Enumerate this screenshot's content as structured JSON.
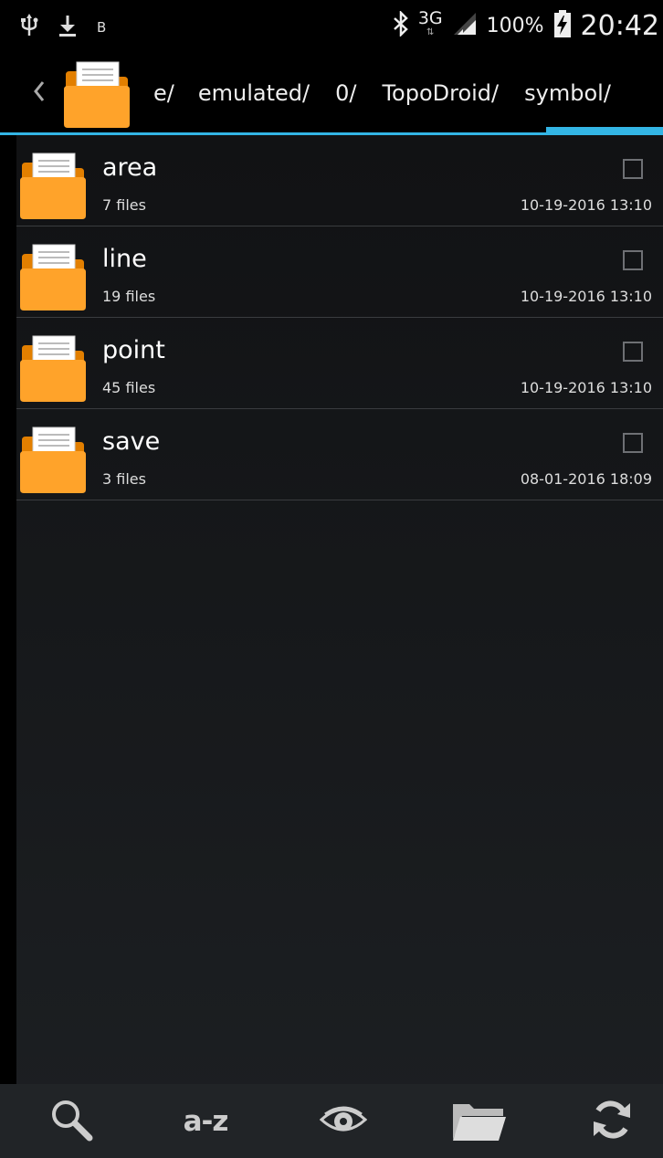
{
  "status_bar": {
    "left_icons": [
      "usb-icon",
      "download-icon"
    ],
    "b_label": "B",
    "network_type": "3G",
    "battery_percent": "100%",
    "clock": "20:42"
  },
  "path_bar": {
    "crumbs": [
      "e/",
      "emulated/",
      "0/",
      "TopoDroid/",
      "symbol/"
    ]
  },
  "files": [
    {
      "name": "area",
      "count": "7 files",
      "date": "10-19-2016 13:10"
    },
    {
      "name": "line",
      "count": "19 files",
      "date": "10-19-2016 13:10"
    },
    {
      "name": "point",
      "count": "45 files",
      "date": "10-19-2016 13:10"
    },
    {
      "name": "save",
      "count": "3 files",
      "date": "08-01-2016 18:09"
    }
  ],
  "toolbar": {
    "sort_label": "a-z",
    "icons": [
      "search-icon",
      "sort-icon",
      "eye-icon",
      "folder-icon",
      "refresh-icon"
    ]
  },
  "colors": {
    "accent": "#33b5e5",
    "folder_orange": "#ff9d1f",
    "background": "#000000"
  }
}
